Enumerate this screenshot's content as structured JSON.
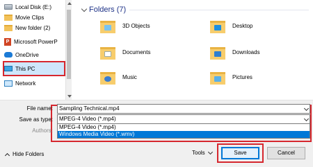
{
  "nav": {
    "items": [
      {
        "label": "Local Disk (E:)",
        "icon": "drive-icon"
      },
      {
        "label": "Movie Clips",
        "icon": "folder-icon"
      },
      {
        "label": "New folder (2)",
        "icon": "folder-icon"
      },
      {
        "label": "Microsoft PowerP",
        "icon": "powerpoint-icon"
      },
      {
        "label": "OneDrive",
        "icon": "onedrive-icon"
      },
      {
        "label": "This PC",
        "icon": "this-pc-icon"
      },
      {
        "label": "Network",
        "icon": "network-icon"
      }
    ]
  },
  "main": {
    "section_title": "Folders (7)",
    "folders": [
      {
        "label": "3D Objects",
        "icon": "3d-objects-folder-icon"
      },
      {
        "label": "Desktop",
        "icon": "desktop-folder-icon"
      },
      {
        "label": "Documents",
        "icon": "documents-folder-icon"
      },
      {
        "label": "Downloads",
        "icon": "downloads-folder-icon"
      },
      {
        "label": "Music",
        "icon": "music-folder-icon"
      },
      {
        "label": "Pictures",
        "icon": "pictures-folder-icon"
      }
    ]
  },
  "form": {
    "file_name_label": "File name:",
    "file_name_value": "Sampling Technical.mp4",
    "save_as_type_label": "Save as type:",
    "save_as_type_value": "MPEG-4 Video (*.mp4)",
    "authors_label": "Authors:",
    "type_options": [
      "MPEG-4 Video (*.mp4)",
      "Windows Media Video (*.wmv)"
    ]
  },
  "footer": {
    "hide_folders_label": "Hide Folders",
    "tools_label": "Tools",
    "save_label": "Save",
    "cancel_label": "Cancel"
  },
  "colors": {
    "highlight_red": "#d6272e",
    "selection_blue": "#0078d7",
    "section_title_blue": "#1e3287"
  }
}
